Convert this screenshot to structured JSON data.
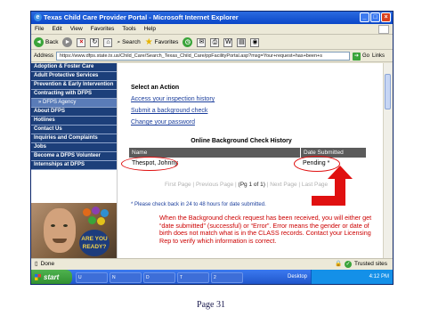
{
  "window": {
    "title": "Texas Child Care Provider Portal - Microsoft Internet Explorer",
    "buttons": [
      "_",
      "□",
      "×"
    ]
  },
  "menubar": [
    "File",
    "Edit",
    "View",
    "Favorites",
    "Tools",
    "Help"
  ],
  "toolbar": {
    "back": "Back",
    "search": "Search",
    "favorites": "Favorites"
  },
  "address": {
    "label": "Address",
    "url": "https://www.dfps.state.tx.us/Child_Care/Search_Texas_Child_Care/ppFacilityPortal.asp?msg=Your+request+has+been+s",
    "go": "Go",
    "links": "Links"
  },
  "sidebar": {
    "items": [
      {
        "label": "Adoption & Foster Care",
        "kind": "main"
      },
      {
        "label": "Adult Protective Services",
        "kind": "main"
      },
      {
        "label": "Prevention & Early Intervention",
        "kind": "main"
      },
      {
        "label": "Contracting with DFPS",
        "kind": "main"
      },
      {
        "label": "» DFPS Agency",
        "kind": "active"
      },
      {
        "label": "About DFPS",
        "kind": "main"
      },
      {
        "label": "Hotlines",
        "kind": "main"
      },
      {
        "label": "Contact Us",
        "kind": "main"
      },
      {
        "label": "Inquiries and Complaints",
        "kind": "main"
      },
      {
        "label": "Jobs",
        "kind": "main"
      },
      {
        "label": "Become a DFPS Volunteer",
        "kind": "main"
      },
      {
        "label": "Internships at DFPS",
        "kind": "main"
      }
    ],
    "promo": "ARE YOU READY?"
  },
  "main": {
    "section_title": "Select an Action",
    "actions": [
      "Access your inspection history",
      "Submit a background check",
      "Change your password"
    ],
    "history_title": "Online Background Check History",
    "columns": [
      "Name",
      "Date Submitted"
    ],
    "rows": [
      {
        "name": "Thespot, Johnny",
        "date": "Pending *"
      }
    ],
    "pager": {
      "first": "First Page",
      "previous": "Previous Page",
      "current": "Pg 1 of 1",
      "next": "Next Page",
      "last": "Last Page"
    },
    "note": "* Please check back in 24 to 48 hours for date submitted."
  },
  "annotation": "When the Background check request has been received, you will either get “date submitted” (successful) or “Error”. Error means the gender or date of birth does not match what is in the CLASS records. Contact your Licensing Rep to verify which information is correct.",
  "status": {
    "left": "Done",
    "right": "Trusted sites"
  },
  "taskbar": {
    "start": "start",
    "items": [
      "U",
      "N",
      "D",
      "T",
      "2"
    ],
    "desktop": "Desktop",
    "clock": "4:12 PM"
  },
  "caption": "Page 31",
  "colors": {
    "nav_blue": "#1c3f7a",
    "link_blue": "#1b3e9c",
    "annotation_red": "#cc0000"
  }
}
